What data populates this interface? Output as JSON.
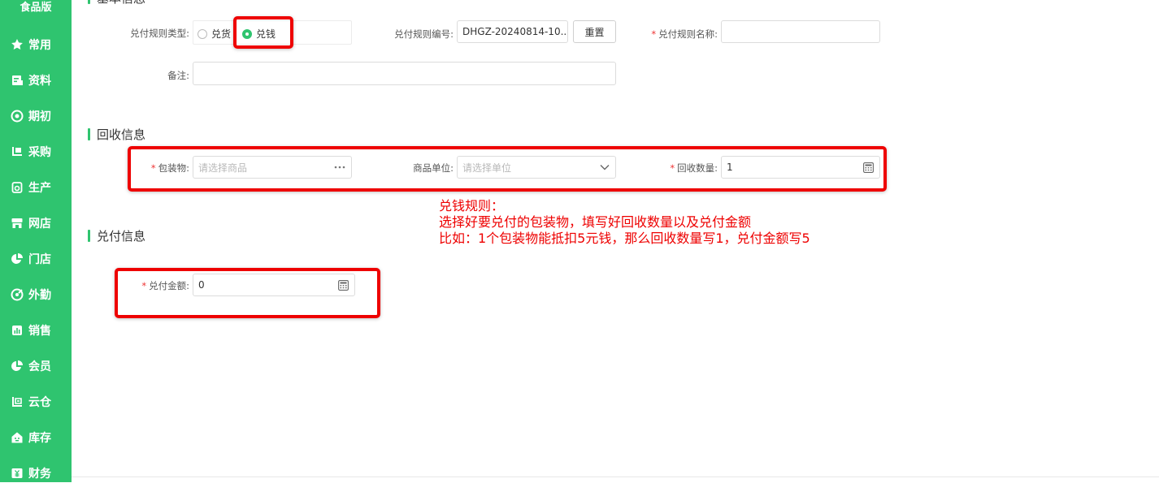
{
  "sidebar": {
    "brand": "食品版",
    "items": [
      {
        "label": "常用",
        "icon": "star-icon"
      },
      {
        "label": "资料",
        "icon": "document-icon"
      },
      {
        "label": "期初",
        "icon": "target-icon"
      },
      {
        "label": "采购",
        "icon": "cart-icon"
      },
      {
        "label": "生产",
        "icon": "production-icon"
      },
      {
        "label": "网店",
        "icon": "store-icon"
      },
      {
        "label": "门店",
        "icon": "pie-icon"
      },
      {
        "label": "外勤",
        "icon": "compass-icon"
      },
      {
        "label": "销售",
        "icon": "chart-icon"
      },
      {
        "label": "会员",
        "icon": "pie-icon"
      },
      {
        "label": "云仓",
        "icon": "warehouse-icon"
      },
      {
        "label": "库存",
        "icon": "home-icon"
      },
      {
        "label": "财务",
        "icon": "finance-icon"
      }
    ]
  },
  "basic": {
    "title": "基本信息",
    "rule_type_label": "兑付规则类型:",
    "rule_type_options": [
      "兑货",
      "兑钱"
    ],
    "rule_type_selected": "兑钱",
    "rule_no_label": "兑付规则编号:",
    "rule_no_value": "DHGZ-20240814-10...",
    "reset_label": "重置",
    "rule_name_label": "兑付规则名称:",
    "rule_name_value": "",
    "remark_label": "备注:",
    "remark_value": ""
  },
  "recycle": {
    "title": "回收信息",
    "package_label": "包装物:",
    "package_placeholder": "请选择商品",
    "unit_label": "商品单位:",
    "unit_placeholder": "请选择单位",
    "qty_label": "回收数量:",
    "qty_value": "1"
  },
  "pay": {
    "title": "兑付信息",
    "amount_label": "兑付金额:",
    "amount_value": "0"
  },
  "annotation": {
    "line1": "兑钱规则：",
    "line2": "选择好要兑付的包装物，填写好回收数量以及兑付金额",
    "line3": "比如：1个包装物能抵扣5元钱，那么回收数量写1，兑付金额写5"
  },
  "colors": {
    "accent": "#2fc46f",
    "highlight": "#ee0000"
  }
}
